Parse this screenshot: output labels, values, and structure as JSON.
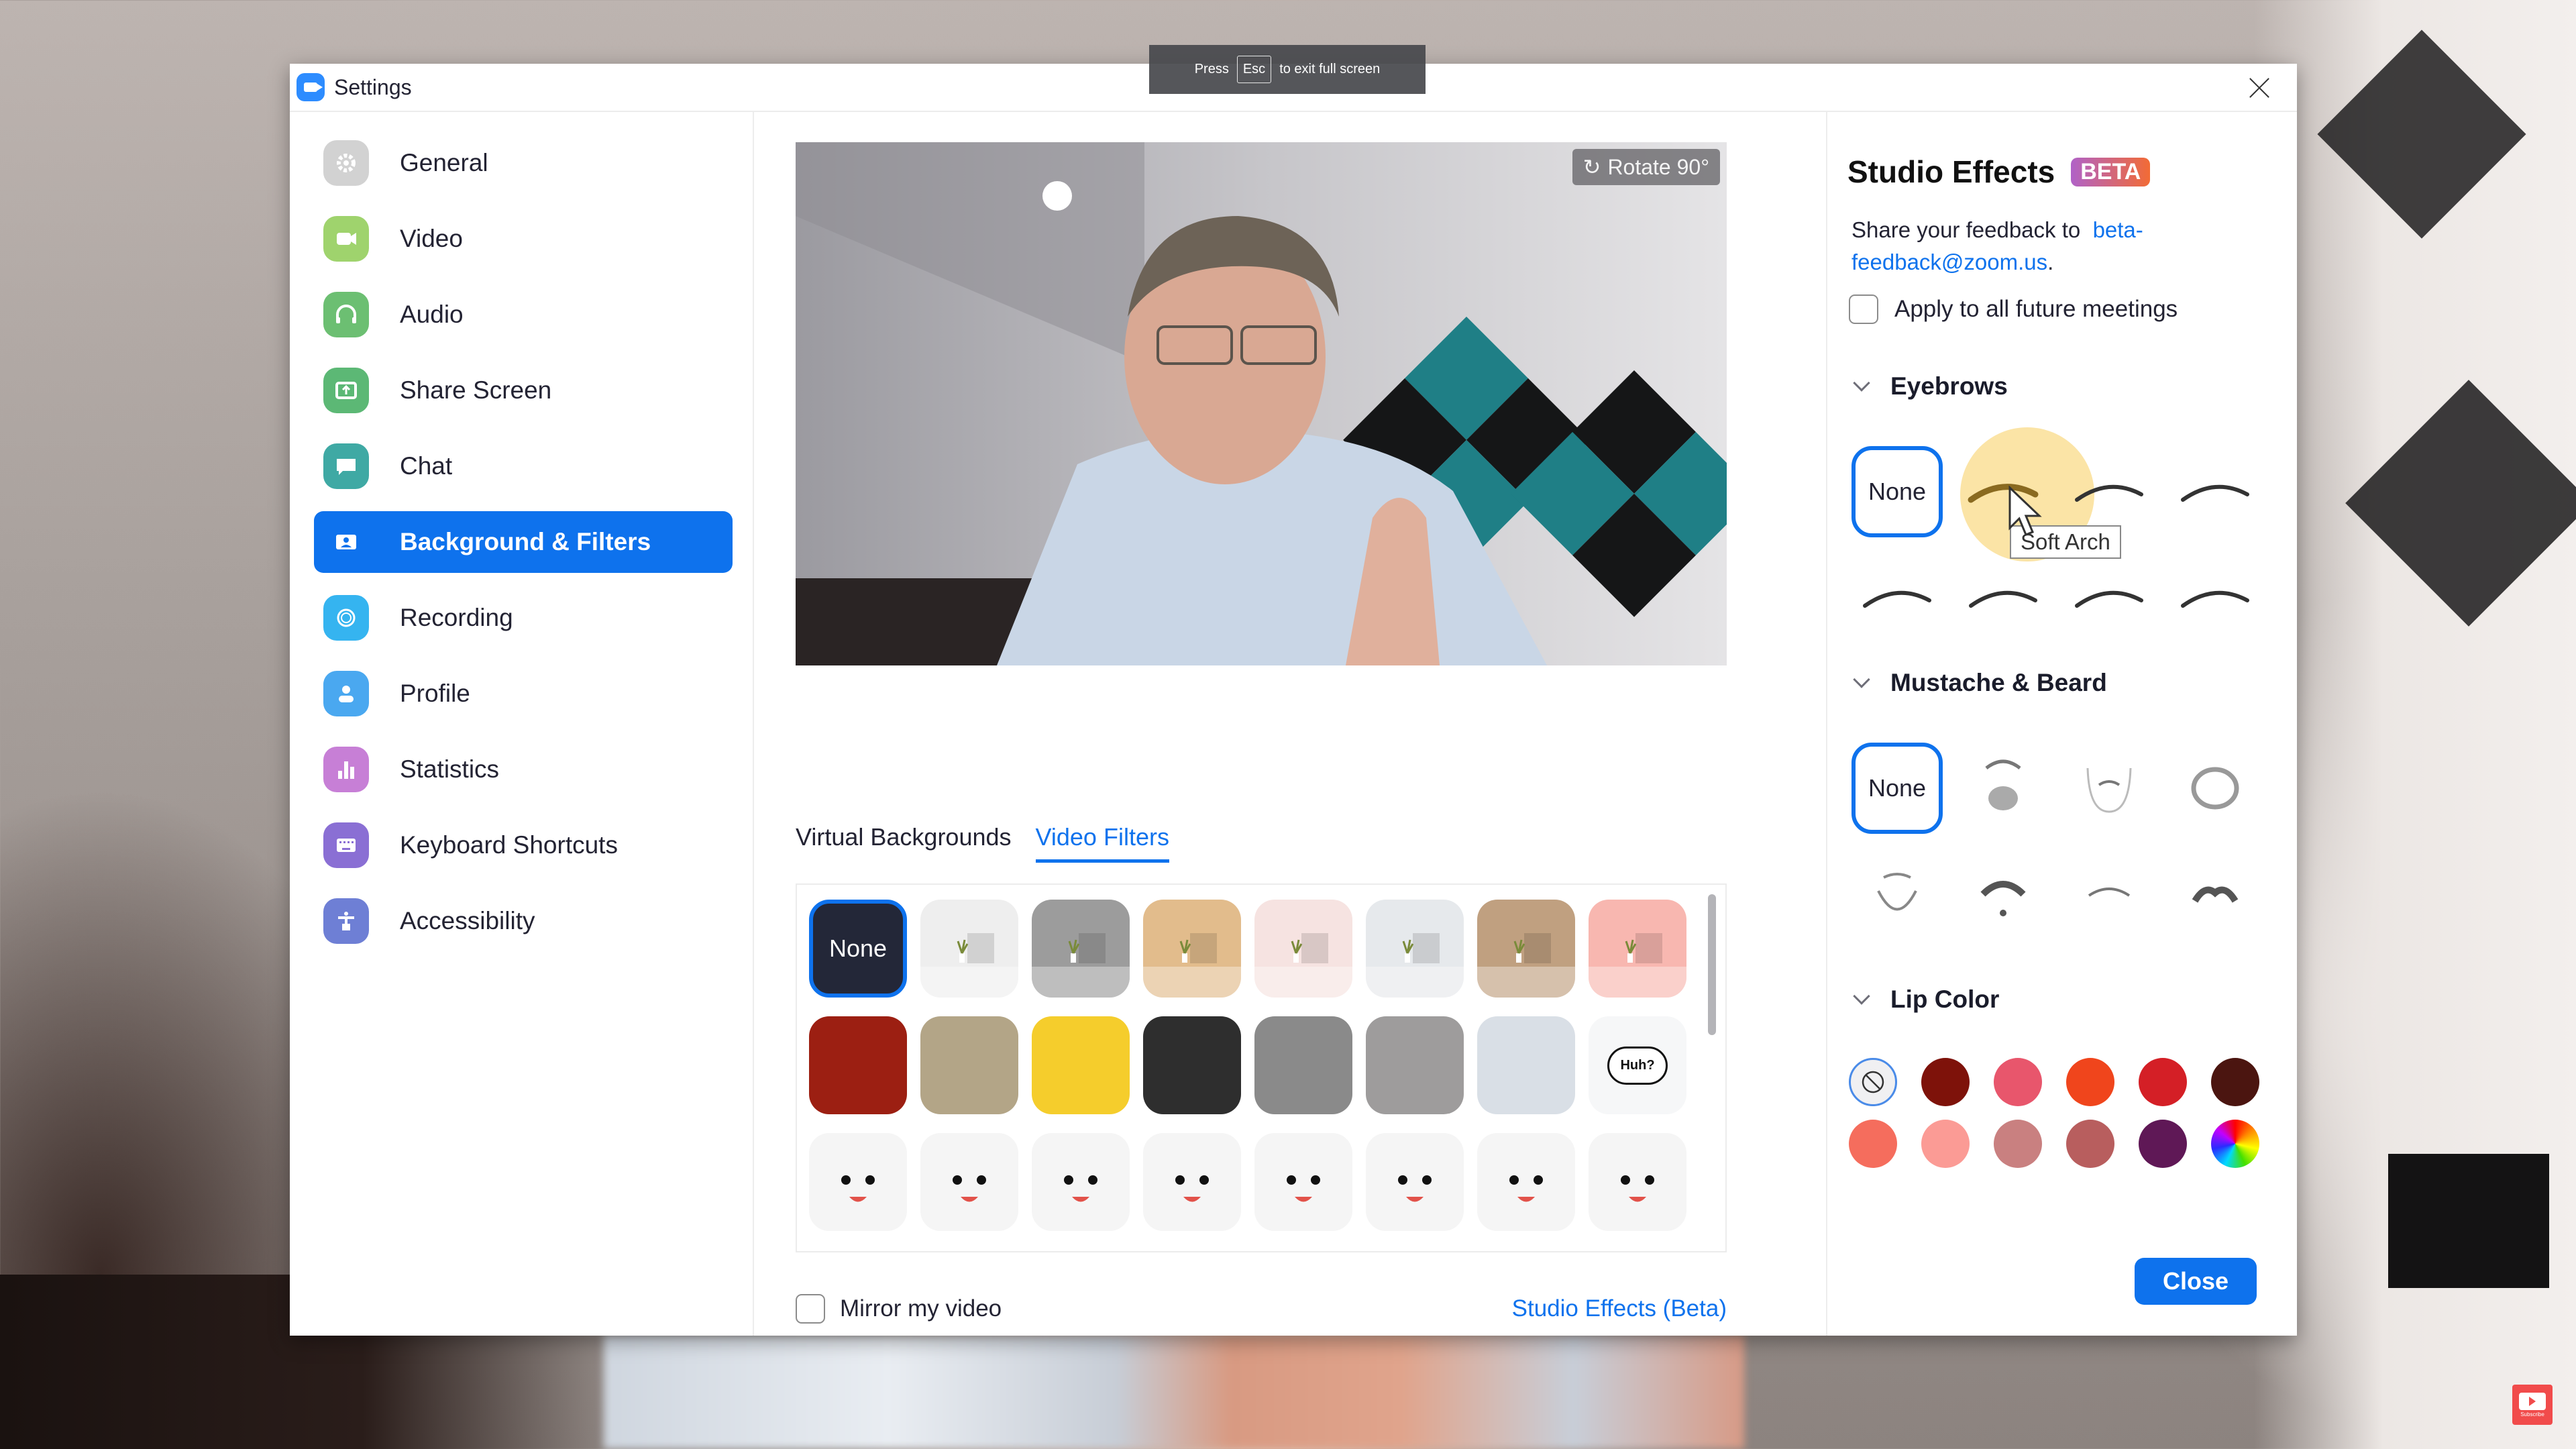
{
  "fullscreen_hint": {
    "press": "Press",
    "key": "Esc",
    "rest": "to exit full screen"
  },
  "window": {
    "title": "Settings",
    "close_icon": "close-icon"
  },
  "sidebar": {
    "items": [
      {
        "label": "General",
        "icon": "gear-icon",
        "color": "#d2d2d2",
        "active": false
      },
      {
        "label": "Video",
        "icon": "video-camera-icon",
        "color": "#9fd36d",
        "active": false
      },
      {
        "label": "Audio",
        "icon": "headphones-icon",
        "color": "#6cbf72",
        "active": false
      },
      {
        "label": "Share Screen",
        "icon": "share-screen-icon",
        "color": "#5cb875",
        "active": false
      },
      {
        "label": "Chat",
        "icon": "chat-bubble-icon",
        "color": "#3fa9a4",
        "active": false
      },
      {
        "label": "Background & Filters",
        "icon": "portrait-icon",
        "color": "#0e72ed",
        "active": true
      },
      {
        "label": "Recording",
        "icon": "record-icon",
        "color": "#35b4f0",
        "active": false
      },
      {
        "label": "Profile",
        "icon": "person-icon",
        "color": "#4aa8f0",
        "active": false
      },
      {
        "label": "Statistics",
        "icon": "bar-chart-icon",
        "color": "#c77fd6",
        "active": false
      },
      {
        "label": "Keyboard Shortcuts",
        "icon": "keyboard-icon",
        "color": "#8a6fd4",
        "active": false
      },
      {
        "label": "Accessibility",
        "icon": "accessibility-icon",
        "color": "#6e7fd5",
        "active": false
      }
    ]
  },
  "main": {
    "preview": {
      "rotate_label": "Rotate 90°"
    },
    "tabs": [
      {
        "label": "Virtual Backgrounds",
        "active": false
      },
      {
        "label": "Video Filters",
        "active": true
      }
    ],
    "filters": {
      "selected_label": "None",
      "items": [
        {
          "name": "none",
          "label": "None",
          "color": "#232738"
        },
        {
          "name": "room-white",
          "color": "#eeeeee"
        },
        {
          "name": "room-gray",
          "color": "#9c9c9c"
        },
        {
          "name": "room-tan",
          "color": "#e2bc8c"
        },
        {
          "name": "room-blush",
          "color": "#f6e3e1"
        },
        {
          "name": "room-light-gray",
          "color": "#e6e9ec"
        },
        {
          "name": "room-brown",
          "color": "#c0a080"
        },
        {
          "name": "room-pink",
          "color": "#f8b7b0"
        },
        {
          "name": "theater",
          "color": "#9c1f12"
        },
        {
          "name": "retro-tv",
          "color": "#b3a587"
        },
        {
          "name": "emoji-frame",
          "color": "#f5cd2c"
        },
        {
          "name": "bulb-frame",
          "color": "#2e2e2e"
        },
        {
          "name": "camera-frame",
          "color": "#8a8a8a"
        },
        {
          "name": "old-tv",
          "color": "#9e9c9c"
        },
        {
          "name": "medal-ribbon",
          "color": "#d9dfe6"
        },
        {
          "name": "speech-bubble",
          "label": "Huh?",
          "color": "#f6f7f8"
        },
        {
          "name": "pixel-sunglasses",
          "color": "#f5f5f5"
        },
        {
          "name": "sprout-face",
          "color": "#f5f5f5"
        },
        {
          "name": "rainbow-face",
          "color": "#f5f5f5"
        },
        {
          "name": "pizza-face",
          "color": "#f5f5f5"
        },
        {
          "name": "cap-face",
          "color": "#f5f5f5"
        },
        {
          "name": "happy-face",
          "color": "#f5f5f5"
        },
        {
          "name": "n95-mask",
          "color": "#f5f5f5"
        },
        {
          "name": "surgical-mask",
          "color": "#f5f5f5"
        }
      ]
    },
    "mirror_label": "Mirror my video",
    "mirror_checked": false,
    "studio_effects_link": "Studio Effects (Beta)"
  },
  "effects": {
    "title": "Studio Effects",
    "badge": "BETA",
    "feedback_text": "Share your feedback to",
    "feedback_email": "beta-feedback@zoom.us",
    "feedback_period": ".",
    "apply_label": "Apply to all future meetings",
    "apply_checked": false,
    "eyebrows": {
      "label": "Eyebrows",
      "none_label": "None",
      "hover_tooltip": "Soft Arch",
      "items": [
        "none",
        "soft-arch",
        "eyebrow-3",
        "eyebrow-4",
        "eyebrow-5",
        "eyebrow-6",
        "eyebrow-7",
        "eyebrow-8"
      ]
    },
    "beard": {
      "label": "Mustache & Beard",
      "none_label": "None",
      "items": [
        "none",
        "full-beard",
        "goatee",
        "circle-beard",
        "chinstrap",
        "mustache-soul-patch",
        "thin-mustache",
        "handlebar"
      ]
    },
    "lip_color": {
      "label": "Lip Color",
      "selected": "none",
      "colors": [
        "none",
        "#7e120a",
        "#e8566c",
        "#f0451c",
        "#d41f26",
        "#4b1510",
        "#f56d5d",
        "#fb9b95",
        "#c98080",
        "#b85e5e",
        "#5f1856",
        "rainbow"
      ]
    },
    "close_label": "Close"
  },
  "overlay": {
    "subscribe_label": "Subscribe"
  }
}
